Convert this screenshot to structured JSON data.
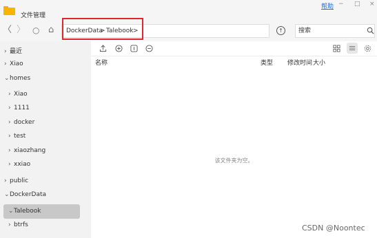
{
  "window": {
    "title": "文件管理",
    "help_label": "帮助",
    "minimize_glyph": "−",
    "maximize_glyph": "□",
    "close_glyph": "×"
  },
  "nav": {
    "back_glyph": "〈",
    "forward_glyph": "〉",
    "refresh_glyph": "○",
    "home_glyph": "⌂"
  },
  "breadcrumb": {
    "segment1": "DockerData",
    "separator1": ">",
    "segment2": "Talebook",
    "separator2": ">"
  },
  "search": {
    "placeholder": "搜索"
  },
  "sidebar": {
    "items": [
      {
        "arrow": "›",
        "label": "最近"
      },
      {
        "arrow": "›",
        "label": "Xiao"
      },
      {
        "arrow": "⌄",
        "label": "homes"
      },
      {
        "arrow": "›",
        "label": "Xiao"
      },
      {
        "arrow": "›",
        "label": "1111"
      },
      {
        "arrow": "›",
        "label": "docker"
      },
      {
        "arrow": "›",
        "label": "test"
      },
      {
        "arrow": "›",
        "label": "xiaozhang"
      },
      {
        "arrow": "›",
        "label": "xxiao"
      },
      {
        "arrow": "›",
        "label": "public"
      },
      {
        "arrow": "⌄",
        "label": "DockerData"
      },
      {
        "arrow": "⌄",
        "label": "Talebook"
      },
      {
        "arrow": "›",
        "label": "btrfs"
      }
    ]
  },
  "columns": {
    "name": "名称",
    "type": "类型",
    "modified": "修改时间",
    "size": "大小"
  },
  "main": {
    "empty_message": "该文件夹为空。"
  },
  "watermark": "CSDN @Noontec",
  "colors": {
    "accent_link": "#2d6bd4",
    "highlight_border": "#e0262b",
    "folder_icon": "#f7b500",
    "selected_bg": "#c8c8c8"
  }
}
